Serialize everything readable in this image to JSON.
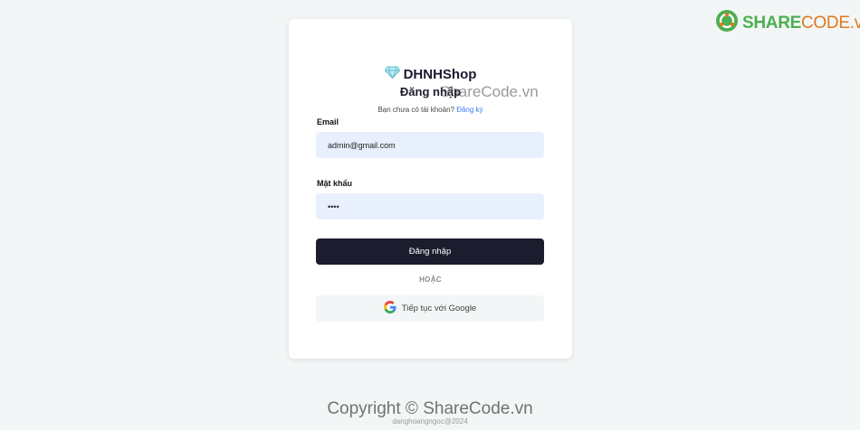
{
  "brand": {
    "name": "DHNHShop",
    "icon": "diamond-icon",
    "color": "#5bbcd0"
  },
  "login": {
    "title": "Đăng nhập",
    "subtitle_prefix": "Bạn chưa có tài khoản?",
    "subtitle_link": "Đăng ký",
    "email_label": "Email",
    "email_value": "admin@gmail.com",
    "password_label": "Mật khẩu",
    "password_value": "••••",
    "submit_label": "Đăng nhập",
    "divider": "HOẶC",
    "google_label": "Tiếp tục với Google",
    "google_icon": "google-icon"
  },
  "watermark": {
    "logo_share": "SHARE",
    "logo_code": "CODE.vn",
    "center_text": "ShareCode.vn",
    "copyright": "Copyright © ShareCode.vn"
  },
  "footer": {
    "text": "danghoangngoc@2024"
  },
  "colors": {
    "primary": "#1b1d2e",
    "input_bg": "#e8effd",
    "page_bg": "#f3f6f6"
  }
}
